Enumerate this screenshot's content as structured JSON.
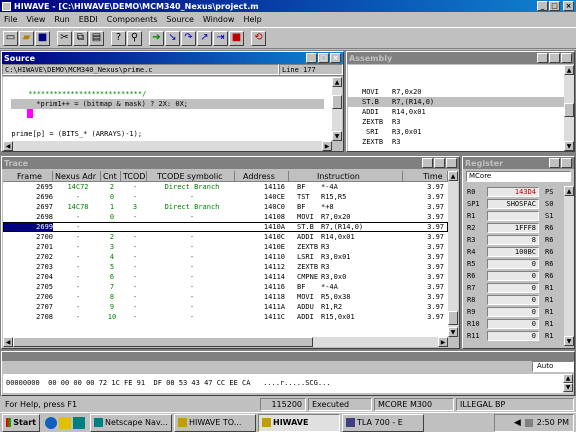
{
  "app": {
    "title": "HIWAVE - [C:\\HIWAVE\\DEMO\\MCM340_Nexus\\project.m",
    "menu": [
      "File",
      "View",
      "Run",
      "EBDI",
      "Components",
      "Source",
      "Window",
      "Help"
    ]
  },
  "toolbar": {
    "icons": [
      "new-file-icon",
      "open-folder-icon",
      "save-icon",
      "cut-icon",
      "copy-icon",
      "paste-icon",
      "help-icon",
      "find-icon",
      "go-icon",
      "step-into-icon",
      "step-over-icon",
      "step-out-icon",
      "run-to-icon",
      "stop-icon",
      "reset-icon"
    ]
  },
  "source": {
    "title": "Source",
    "path": "C:\\HIWAVE\\DEMO\\MCM340_Nexus\\prime.c",
    "line": "Line 177",
    "lines": [
      "",
      "      ***************************/",
      "      *prim1++ = (bitmap & mask) ? 2X: 0X;",
      "",
      "",
      "  prime[p] = (BITS_* (ARRAYS)-1);"
    ]
  },
  "assembly": {
    "title": "Assembly",
    "rows": [
      {
        "op": "",
        "args": ""
      },
      {
        "op": "MOVI",
        "args": "R7,0x20"
      },
      {
        "op": "ST.B",
        "args": "R7,(R14,0)"
      },
      {
        "op": "ADDI",
        "args": "R14,0x01"
      },
      {
        "op": "ZEXTB",
        "args": "R3"
      },
      {
        "op": "SRI",
        "args": "R3,0x01"
      },
      {
        "op": "ZEXTB",
        "args": "R3"
      }
    ]
  },
  "trace": {
    "title": "Trace",
    "columns": [
      "Frame",
      "Nexus Adr",
      "Cnt",
      "TCODE",
      "TCODE symbolic",
      "Address",
      "Instruction",
      "Time"
    ],
    "rows": [
      {
        "frame": "2695",
        "nexus": "14C72",
        "cnt": "2",
        "tcode": "-",
        "sym": "Direct Branch",
        "addr": "14116",
        "op": "BF",
        "args": "*-4A",
        "time": "3.97",
        "selected": false
      },
      {
        "frame": "2696",
        "nexus": "-",
        "cnt": "0",
        "tcode": "-",
        "sym": "-",
        "addr": "140CE",
        "op": "TST",
        "args": "R15,R5",
        "time": "3.97",
        "selected": false
      },
      {
        "frame": "2697",
        "nexus": "14C78",
        "cnt": "1",
        "tcode": "3",
        "sym": "Direct Branch",
        "addr": "140C0",
        "op": "BF",
        "args": "*+8",
        "time": "3.97",
        "selected": false
      },
      {
        "frame": "2698",
        "nexus": "-",
        "cnt": "0",
        "tcode": "-",
        "sym": "-",
        "addr": "14108",
        "op": "MOVI",
        "args": "R7,0x20",
        "time": "3.97",
        "selected": false
      },
      {
        "frame": "2699",
        "nexus": "-",
        "cnt": "",
        "tcode": "",
        "sym": "",
        "addr": "1410A",
        "op": "ST.B",
        "args": "R7,(R14,0)",
        "time": "3.97",
        "selected": true
      },
      {
        "frame": "2700",
        "nexus": "-",
        "cnt": "2",
        "tcode": "-",
        "sym": "-",
        "addr": "1410C",
        "op": "ADDI",
        "args": "R14,0x01",
        "time": "3.97",
        "selected": false
      },
      {
        "frame": "2701",
        "nexus": "-",
        "cnt": "3",
        "tcode": "-",
        "sym": "-",
        "addr": "1410E",
        "op": "ZEXTB",
        "args": "R3",
        "time": "3.97",
        "selected": false
      },
      {
        "frame": "2702",
        "nexus": "-",
        "cnt": "4",
        "tcode": "-",
        "sym": "-",
        "addr": "14110",
        "op": "LSRI",
        "args": "R3,0x01",
        "time": "3.97",
        "selected": false
      },
      {
        "frame": "2703",
        "nexus": "-",
        "cnt": "5",
        "tcode": "-",
        "sym": "-",
        "addr": "14112",
        "op": "ZEXTB",
        "args": "R3",
        "time": "3.97",
        "selected": false
      },
      {
        "frame": "2704",
        "nexus": "-",
        "cnt": "6",
        "tcode": "-",
        "sym": "-",
        "addr": "14114",
        "op": "CMPNEI",
        "args": "R3,0x0",
        "time": "3.97",
        "selected": false
      },
      {
        "frame": "2705",
        "nexus": "-",
        "cnt": "7",
        "tcode": "-",
        "sym": "-",
        "addr": "14116",
        "op": "BF",
        "args": "*-4A",
        "time": "3.97",
        "selected": false
      },
      {
        "frame": "2706",
        "nexus": "-",
        "cnt": "8",
        "tcode": "-",
        "sym": "-",
        "addr": "14118",
        "op": "MOVI",
        "args": "R5,0x38",
        "time": "3.97",
        "selected": false
      },
      {
        "frame": "2707",
        "nexus": "-",
        "cnt": "9",
        "tcode": "-",
        "sym": "-",
        "addr": "1411A",
        "op": "ADDU",
        "args": "R1,R2",
        "time": "3.97",
        "selected": false
      },
      {
        "frame": "2708",
        "nexus": "-",
        "cnt": "10",
        "tcode": "-",
        "sym": "-",
        "addr": "1411C",
        "op": "ADDI",
        "args": "R15,0x01",
        "time": "3.97",
        "selected": false
      }
    ]
  },
  "register": {
    "title": "Register",
    "header": "MCore",
    "rows": [
      {
        "name": "R0",
        "value": "143D4",
        "extra": "PS"
      },
      {
        "name": "SP1",
        "value": "SHOSFAC",
        "extra": "S0"
      },
      {
        "name": "R1",
        "value": "",
        "extra": "S1"
      },
      {
        "name": "R2",
        "value": "1FFF8",
        "extra": "R6"
      },
      {
        "name": "R3",
        "value": "8",
        "extra": "R6"
      },
      {
        "name": "R4",
        "value": "100BC",
        "extra": "R6"
      },
      {
        "name": "R5",
        "value": "0",
        "extra": "R6"
      },
      {
        "name": "R6",
        "value": "0",
        "extra": "R6"
      },
      {
        "name": "R7",
        "value": "0",
        "extra": "R1"
      },
      {
        "name": "R8",
        "value": "0",
        "extra": "R1"
      },
      {
        "name": "R9",
        "value": "0",
        "extra": "R1"
      },
      {
        "name": "R10",
        "value": "0",
        "extra": "R1"
      },
      {
        "name": "R11",
        "value": "0",
        "extra": "R1"
      }
    ]
  },
  "memory": {
    "mode": "Auto",
    "line": "00000000  00 00 00 00 72 1C FE 91  DF 08 53 43 47 CC EE CA   ....r.....SCG..."
  },
  "status": {
    "hint": "For Help, press F1",
    "cells": [
      "115200",
      "Executed",
      "MCORE M300",
      "ILLEGAL BP"
    ]
  },
  "taskbar": {
    "start": "Start",
    "tasks": [
      "Netscape Nav...",
      "HIWAVE TO...",
      "HIWAVE",
      "TLA 700 - E"
    ],
    "clock": "2:50 PM"
  },
  "colors": {
    "active_title": "#000080",
    "selection": "#000080",
    "breakpoint": "#ff00ff",
    "green_text": "#008000",
    "register_red": "#c00000"
  }
}
